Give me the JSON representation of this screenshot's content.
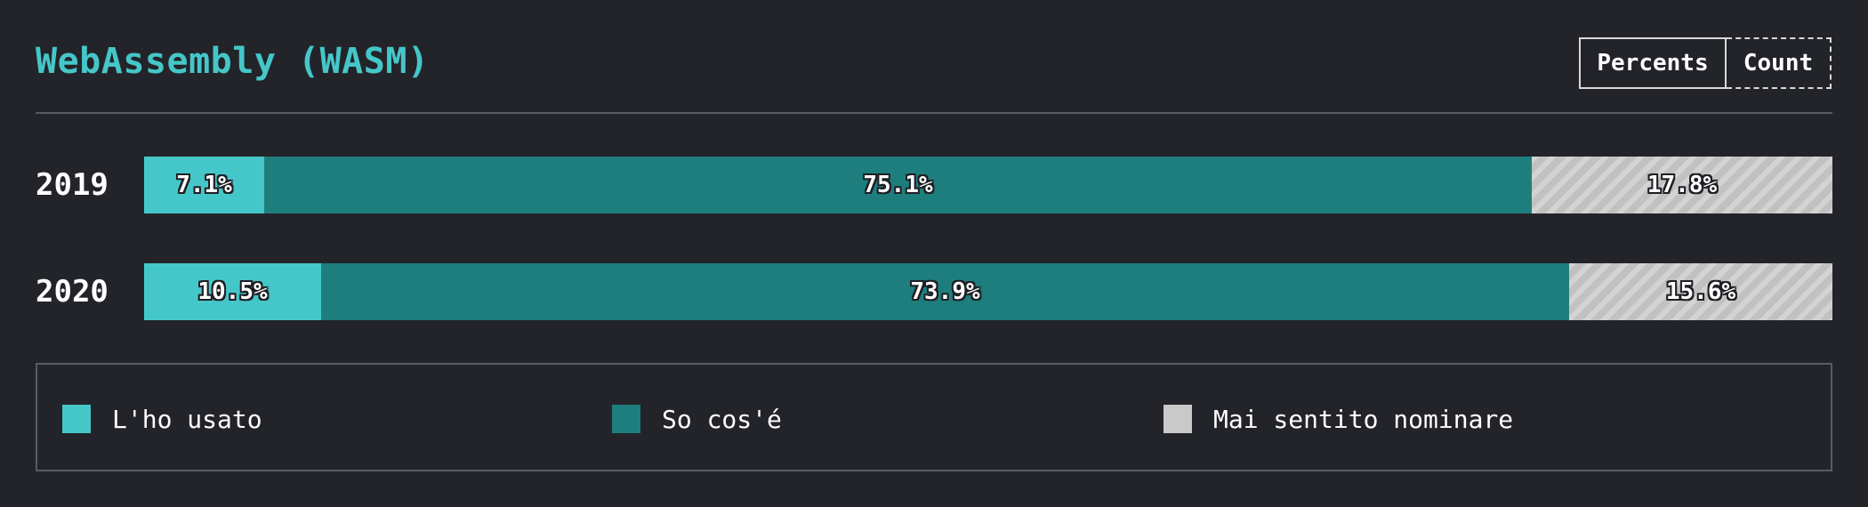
{
  "header": {
    "title": "WebAssembly (WASM)",
    "toggle": {
      "percents_label": "Percents",
      "count_label": "Count",
      "active": "Percents"
    }
  },
  "colors": {
    "background": "#232429",
    "accent": "#45c7c9",
    "used": "#45c7c9",
    "know": "#1e7e7e",
    "never_heard": "#c9c9c9"
  },
  "chart_data": {
    "type": "bar",
    "orientation": "horizontal",
    "stacked": true,
    "title": "WebAssembly (WASM)",
    "categories": [
      "2019",
      "2020"
    ],
    "series": [
      {
        "name": "L'ho usato",
        "values": [
          7.1,
          10.5
        ],
        "labels": [
          "7.1%",
          "10.5%"
        ],
        "color": "#45c7c9"
      },
      {
        "name": "So cos'é",
        "values": [
          75.1,
          73.9
        ],
        "labels": [
          "75.1%",
          "73.9%"
        ],
        "color": "#1e7e7e"
      },
      {
        "name": "Mai sentito nominare",
        "values": [
          17.8,
          15.6
        ],
        "labels": [
          "17.8%",
          "15.6%"
        ],
        "color": "#c9c9c9",
        "pattern": "hatched"
      }
    ],
    "xlim": [
      0,
      100
    ],
    "legend": "bottom"
  },
  "legend": {
    "items": [
      {
        "label": "L'ho usato",
        "color": "#45c7c9"
      },
      {
        "label": "So cos'é",
        "color": "#1e7e7e"
      },
      {
        "label": "Mai sentito nominare",
        "color": "#c9c9c9"
      }
    ]
  }
}
